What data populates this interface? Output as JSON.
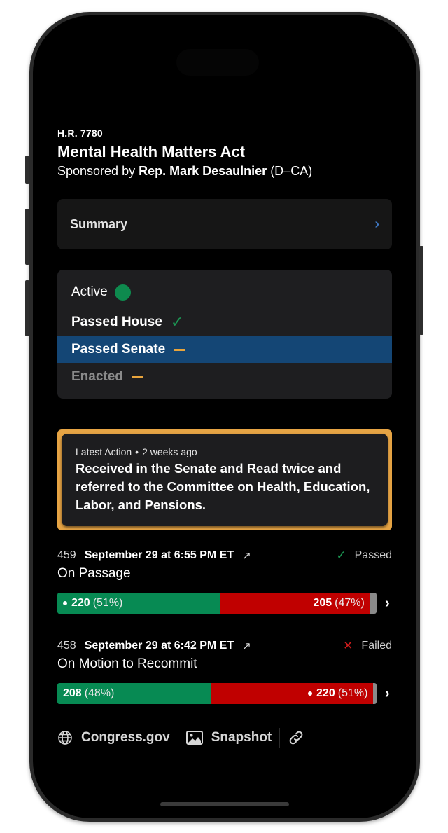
{
  "bill": {
    "number": "H.R. 7780",
    "title": "Mental Health Matters Act",
    "sponsor_prefix": "Sponsored by",
    "sponsor_name": "Rep. Mark Desaulnier",
    "sponsor_party": "(D–CA)"
  },
  "summary": {
    "label": "Summary",
    "icon": "chevron-right-icon"
  },
  "status": {
    "items": [
      {
        "label": "Active",
        "indicator": "green-dot",
        "state": "active"
      },
      {
        "label": "Passed House",
        "indicator": "checkmark",
        "state": "complete"
      },
      {
        "label": "Passed Senate",
        "indicator": "dash",
        "state": "current"
      },
      {
        "label": "Enacted",
        "indicator": "dash",
        "state": "pending"
      }
    ],
    "colors": {
      "green": "#0e8a4e",
      "highlight": "#144675",
      "pending": "#e8a43c"
    }
  },
  "latest_action": {
    "label": "Latest Action",
    "separator": "•",
    "time_ago": "2 weeks ago",
    "text": "Received in the Senate and Read twice and referred to the Committee on Health, Education, Labor, and Pensions.",
    "border_color": "#e6a444"
  },
  "votes": [
    {
      "roll": "459",
      "date": "September 29 at 6:55 PM ET",
      "result": "Passed",
      "result_icon": "checkmark-icon",
      "question": "On Passage",
      "yea": {
        "count": "220",
        "pct": "(51%)",
        "fraction": 0.51,
        "winner": true
      },
      "nay": {
        "count": "205",
        "pct": "(47%)",
        "fraction": 0.47,
        "winner": false
      },
      "other_fraction": 0.02
    },
    {
      "roll": "458",
      "date": "September 29 at 6:42 PM ET",
      "result": "Failed",
      "result_icon": "x-icon",
      "question": "On Motion to Recommit",
      "yea": {
        "count": "208",
        "pct": "(48%)",
        "fraction": 0.48,
        "winner": false
      },
      "nay": {
        "count": "220",
        "pct": "(51%)",
        "fraction": 0.51,
        "winner": true
      },
      "other_fraction": 0.01
    }
  ],
  "vote_colors": {
    "yea": "#078a53",
    "nay": "#c00000",
    "other": "#8a8a8a"
  },
  "footer": {
    "congress_label": "Congress.gov",
    "snapshot_label": "Snapshot"
  }
}
